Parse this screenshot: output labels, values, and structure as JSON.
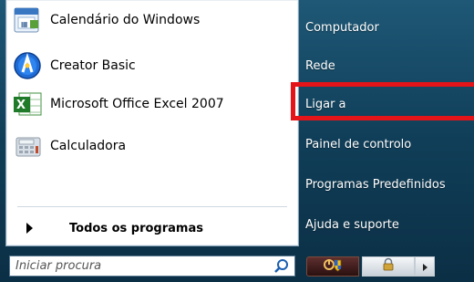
{
  "programs": [
    {
      "label": "Calendário do Windows",
      "icon": "calendar-icon"
    },
    {
      "label": "Creator Basic",
      "icon": "creator-basic-icon"
    },
    {
      "label": "Microsoft Office Excel 2007",
      "icon": "excel-icon"
    },
    {
      "label": "Calculadora",
      "icon": "calculator-icon"
    }
  ],
  "all_programs": {
    "label": "Todos os programas",
    "icon": "triangle-right-icon"
  },
  "search": {
    "placeholder": "Iniciar procura",
    "icon": "search-icon"
  },
  "right": [
    {
      "label": "Computador"
    },
    {
      "label": "Rede"
    },
    {
      "label": "Ligar a"
    },
    {
      "label": "Painel de controlo"
    },
    {
      "label": "Programas Predefinidos"
    },
    {
      "label": "Ajuda e suporte"
    }
  ],
  "power": {
    "shutdown_icon": "power-shield-icon",
    "lock_icon": "lock-icon",
    "arrow_icon": "triangle-right-icon"
  },
  "colors": {
    "highlight": "#e51419",
    "menu_blue": "#103e58"
  }
}
